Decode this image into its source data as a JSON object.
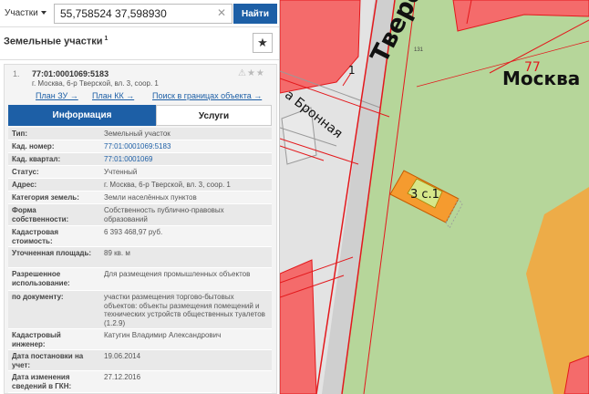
{
  "search": {
    "type_label": "Участки",
    "query": "55,758524 37,598930",
    "clear_glyph": "✕",
    "button_label": "Найти"
  },
  "section": {
    "title": "Земельные участки",
    "count_sup": "1",
    "star_glyph": "★"
  },
  "card": {
    "number": "1.",
    "cad_number": "77:01:0001069:5183",
    "address": "г. Москва, 6-р Тверской, вл. 3, соор. 1",
    "icons": "⚠★★",
    "links": [
      {
        "label": "План ЗУ →"
      },
      {
        "label": "План КК →"
      },
      {
        "label": "Поиск в границах объекта →"
      }
    ],
    "tabs": [
      {
        "label": "Информация"
      },
      {
        "label": "Услуги"
      }
    ],
    "rows": [
      {
        "label": "Тип:",
        "value": "Земельный участок"
      },
      {
        "label": "Кад. номер:",
        "value": "77:01:0001069:5183"
      },
      {
        "label": "Кад. квартал:",
        "value": "77:01:0001069"
      },
      {
        "label": "Статус:",
        "value": "Учтенный"
      },
      {
        "label": "Адрес:",
        "value": "г. Москва, 6-р Тверской, вл. 3, соор. 1"
      },
      {
        "label": "Категория земель:",
        "value": "Земли населённых пунктов"
      },
      {
        "label": "Форма собственности:",
        "value": "Собственность публично-правовых образований"
      },
      {
        "label": "Кадастровая стоимость:",
        "value": "6 393 468,97 руб."
      },
      {
        "label": "Уточненная площадь:",
        "value": "89 кв. м"
      },
      {
        "label": "Разрешенное использование:",
        "value": "Для размещения промышленных объектов"
      },
      {
        "label": "по документу:",
        "value": "участки размещения торгово-бытовых объектов: объекты размещения помещений и технических устройств общественных туалетов (1.2.9)"
      },
      {
        "label": "Кадастровый инженер:",
        "value": "Катугин Владимир Александрович"
      },
      {
        "label": "Дата постановки на учет:",
        "value": "19.06.2014"
      },
      {
        "label": "Дата изменения сведений в ГКН:",
        "value": "27.12.2016"
      }
    ]
  },
  "map": {
    "labels": {
      "boulevard": "Тверской бульвар",
      "bronnaya": "а Бронная",
      "city": "Москва",
      "district": "77",
      "plot": "3 с.1",
      "marker": "1",
      "small_num": "131"
    },
    "colors": {
      "lawn": "#b6d69a",
      "road": "#e3e3e3",
      "building": "#f46b6b",
      "boundary": "#e3181c",
      "plot_fill": "#f59b2f",
      "plot_inner": "#d6e78a",
      "accent_blue": "#1d5fa6"
    }
  }
}
